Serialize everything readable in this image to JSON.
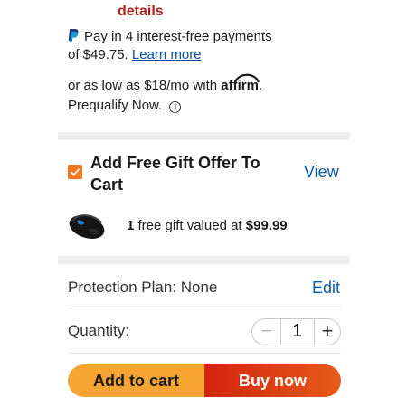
{
  "top": {
    "details_link": "details"
  },
  "paypal": {
    "line1": "Pay in 4 interest-free payments",
    "line2_prefix": "of $49.75.",
    "learn_more": "Learn more"
  },
  "affirm": {
    "prefix": "or as low as $18/mo with",
    "logo": "affirm",
    "logo_suffix": ".",
    "prequalify": "Prequalify Now.",
    "info_glyph": "i"
  },
  "gift": {
    "title": "Add Free Gift Offer To Cart",
    "checked": true,
    "view_label": "View",
    "count": "1",
    "text": "free gift valued at",
    "value": "$99.99"
  },
  "protection": {
    "label": "Protection Plan: None",
    "edit_label": "Edit"
  },
  "quantity": {
    "label": "Quantity:",
    "value": "1",
    "minus": "−",
    "plus": "+"
  },
  "actions": {
    "add_to_cart": "Add to cart",
    "buy_now": "Buy now"
  },
  "colors": {
    "accent_orange": "#f1761d",
    "link_blue": "#0b5cab",
    "cart_button": "#f7a532",
    "buy_button": "#d4230f",
    "details_red": "#b1221b"
  }
}
